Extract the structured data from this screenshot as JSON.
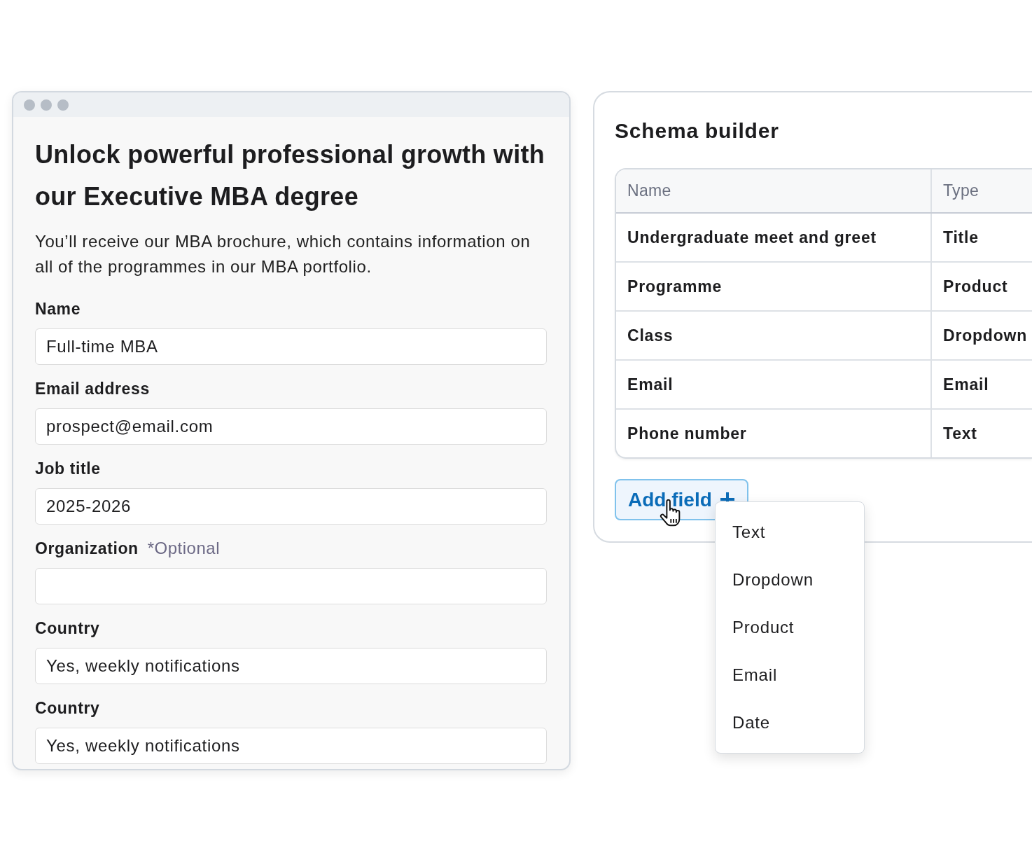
{
  "form_window": {
    "heading": "Unlock powerful professional growth with our Executive MBA degree",
    "intro": "You’ll receive our MBA brochure, which contains information on all of the programmes in our MBA portfolio.",
    "fields": [
      {
        "label": "Name",
        "value": "Full-time MBA"
      },
      {
        "label": "Email address",
        "value": "prospect@email.com"
      },
      {
        "label": "Job title",
        "value": "2025-2026"
      },
      {
        "label": "Organization",
        "hint": "*Optional"
      },
      {
        "label": "Country",
        "value": "Yes, weekly notifications"
      },
      {
        "label": "Country",
        "value": "Yes, weekly notifications"
      }
    ]
  },
  "schema_builder": {
    "title": "Schema builder",
    "table": {
      "columns": [
        "Name",
        "Type"
      ],
      "rows": [
        [
          "Undergraduate meet and greet",
          "Title"
        ],
        [
          "Programme",
          "Product"
        ],
        [
          "Class",
          "Dropdown"
        ],
        [
          "Email",
          "Email"
        ],
        [
          "Phone number",
          "Text"
        ]
      ]
    },
    "add_button": {
      "label": "Add field"
    },
    "menu": {
      "items": [
        "Text",
        "Dropdown",
        "Product",
        "Email",
        "Date"
      ]
    }
  }
}
